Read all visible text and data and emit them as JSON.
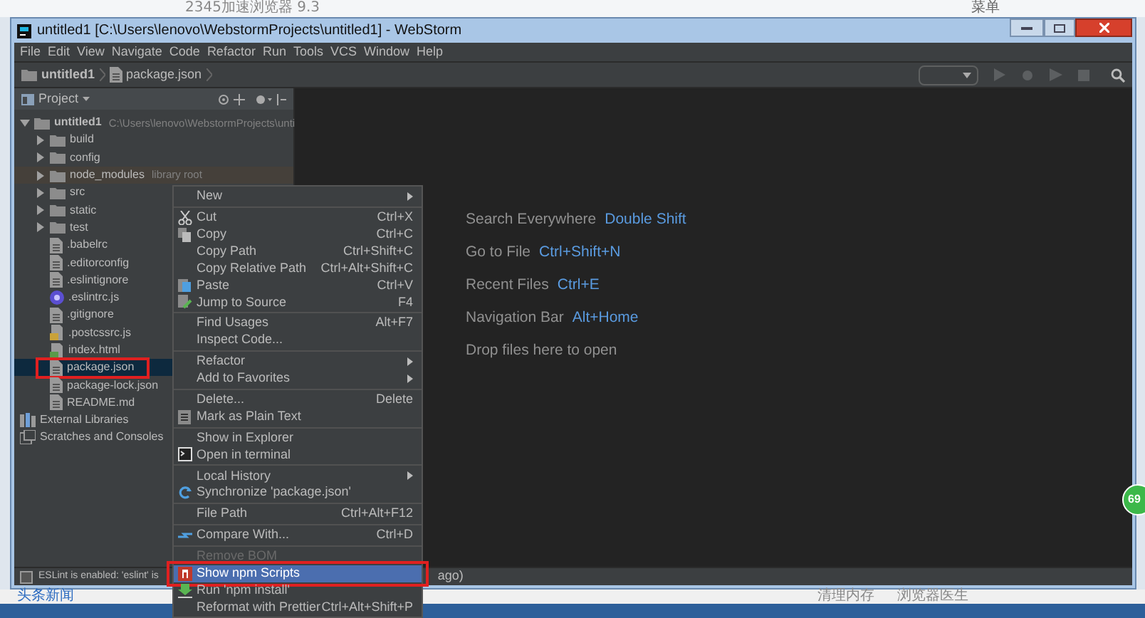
{
  "desktop": {
    "browser_title": "2345加速浏览器 9.3",
    "browser_menu": "菜单",
    "news_label": "头条新闻",
    "tray_items": [
      "清理内存",
      "浏览器医生"
    ]
  },
  "window": {
    "title": "untitled1 [C:\\Users\\lenovo\\WebstormProjects\\untitled1] - WebStorm"
  },
  "menu_bar": [
    "File",
    "Edit",
    "View",
    "Navigate",
    "Code",
    "Refactor",
    "Run",
    "Tools",
    "VCS",
    "Window",
    "Help"
  ],
  "breadcrumbs": [
    {
      "label": "untitled1",
      "kind": "folder"
    },
    {
      "label": "package.json",
      "kind": "file"
    }
  ],
  "project_panel": {
    "title": "Project",
    "tree": [
      {
        "label": "untitled1",
        "note": "C:\\Users\\lenovo\\WebstormProjects\\unti",
        "kind": "folder",
        "expanded": true,
        "selected": false,
        "children": [
          {
            "label": "build",
            "kind": "folder",
            "expanded": false,
            "selected": false
          },
          {
            "label": "config",
            "kind": "folder",
            "expanded": false,
            "selected": false
          },
          {
            "label": "node_modules",
            "note": "library root",
            "kind": "library_folder",
            "expanded": false,
            "selected": false
          },
          {
            "label": "src",
            "kind": "folder",
            "expanded": false,
            "selected": false
          },
          {
            "label": "static",
            "kind": "folder",
            "expanded": false,
            "selected": false
          },
          {
            "label": "test",
            "kind": "folder",
            "expanded": false,
            "selected": false
          },
          {
            "label": ".babelrc",
            "kind": "file",
            "selected": false
          },
          {
            "label": ".editorconfig",
            "kind": "file",
            "selected": false
          },
          {
            "label": ".eslintignore",
            "kind": "file",
            "selected": false
          },
          {
            "label": ".eslintrc.js",
            "kind": "eslint_file",
            "selected": false
          },
          {
            "label": ".gitignore",
            "kind": "file",
            "selected": false
          },
          {
            "label": ".postcssrc.js",
            "kind": "script_file",
            "selected": false
          },
          {
            "label": "index.html",
            "kind": "html_file",
            "selected": false
          },
          {
            "label": "package.json",
            "kind": "file",
            "selected": true,
            "annotated": true
          },
          {
            "label": "package-lock.json",
            "kind": "file",
            "selected": false
          },
          {
            "label": "README.md",
            "kind": "file",
            "selected": false
          }
        ]
      },
      {
        "label": "External Libraries",
        "kind": "libraries",
        "selected": false
      },
      {
        "label": "Scratches and Consoles",
        "kind": "scratches",
        "selected": false
      }
    ]
  },
  "welcome_hints": [
    {
      "label": "Search Everywhere",
      "shortcut": "Double Shift"
    },
    {
      "label": "Go to File",
      "shortcut": "Ctrl+Shift+N"
    },
    {
      "label": "Recent Files",
      "shortcut": "Ctrl+E"
    },
    {
      "label": "Navigation Bar",
      "shortcut": "Alt+Home"
    },
    {
      "label": "Drop files here to open"
    }
  ],
  "context_menu": [
    {
      "kind": "item",
      "label": "New",
      "submenu": true
    },
    {
      "kind": "separator"
    },
    {
      "kind": "cut",
      "label": "Cut",
      "shortcut": "Ctrl+X"
    },
    {
      "kind": "copy",
      "label": "Copy",
      "shortcut": "Ctrl+C"
    },
    {
      "kind": "item",
      "label": "Copy Path",
      "shortcut": "Ctrl+Shift+C"
    },
    {
      "kind": "item",
      "label": "Copy Relative Path",
      "shortcut": "Ctrl+Alt+Shift+C"
    },
    {
      "kind": "paste",
      "label": "Paste",
      "shortcut": "Ctrl+V"
    },
    {
      "kind": "jump",
      "label": "Jump to Source",
      "shortcut": "F4"
    },
    {
      "kind": "separator"
    },
    {
      "kind": "item",
      "label": "Find Usages",
      "shortcut": "Alt+F7"
    },
    {
      "kind": "item",
      "label": "Inspect Code..."
    },
    {
      "kind": "separator"
    },
    {
      "kind": "item",
      "label": "Refactor",
      "submenu": true
    },
    {
      "kind": "item",
      "label": "Add to Favorites",
      "submenu": true
    },
    {
      "kind": "separator"
    },
    {
      "kind": "item",
      "label": "Delete...",
      "shortcut": "Delete"
    },
    {
      "kind": "plaintext",
      "label": "Mark as Plain Text"
    },
    {
      "kind": "separator"
    },
    {
      "kind": "item",
      "label": "Show in Explorer"
    },
    {
      "kind": "terminal",
      "label": "Open in terminal"
    },
    {
      "kind": "separator"
    },
    {
      "kind": "item",
      "label": "Local History",
      "submenu": true
    },
    {
      "kind": "sync",
      "label": "Synchronize 'package.json'"
    },
    {
      "kind": "separator"
    },
    {
      "kind": "item",
      "label": "File Path",
      "shortcut": "Ctrl+Alt+F12"
    },
    {
      "kind": "separator"
    },
    {
      "kind": "compare",
      "label": "Compare With...",
      "shortcut": "Ctrl+D"
    },
    {
      "kind": "separator"
    },
    {
      "kind": "item",
      "label": "Remove BOM",
      "disabled": true
    },
    {
      "kind": "npm",
      "label": "Show npm Scripts",
      "selected": true,
      "annotated": true
    },
    {
      "kind": "install",
      "label": "Run 'npm install'"
    },
    {
      "kind": "item",
      "label": "Reformat with Prettier",
      "shortcut": "Ctrl+Alt+Shift+P"
    }
  ],
  "status_bar": {
    "text_left": "ESLint is enabled: 'eslint' is",
    "text_right": "ago)"
  },
  "floating_badge": "69"
}
